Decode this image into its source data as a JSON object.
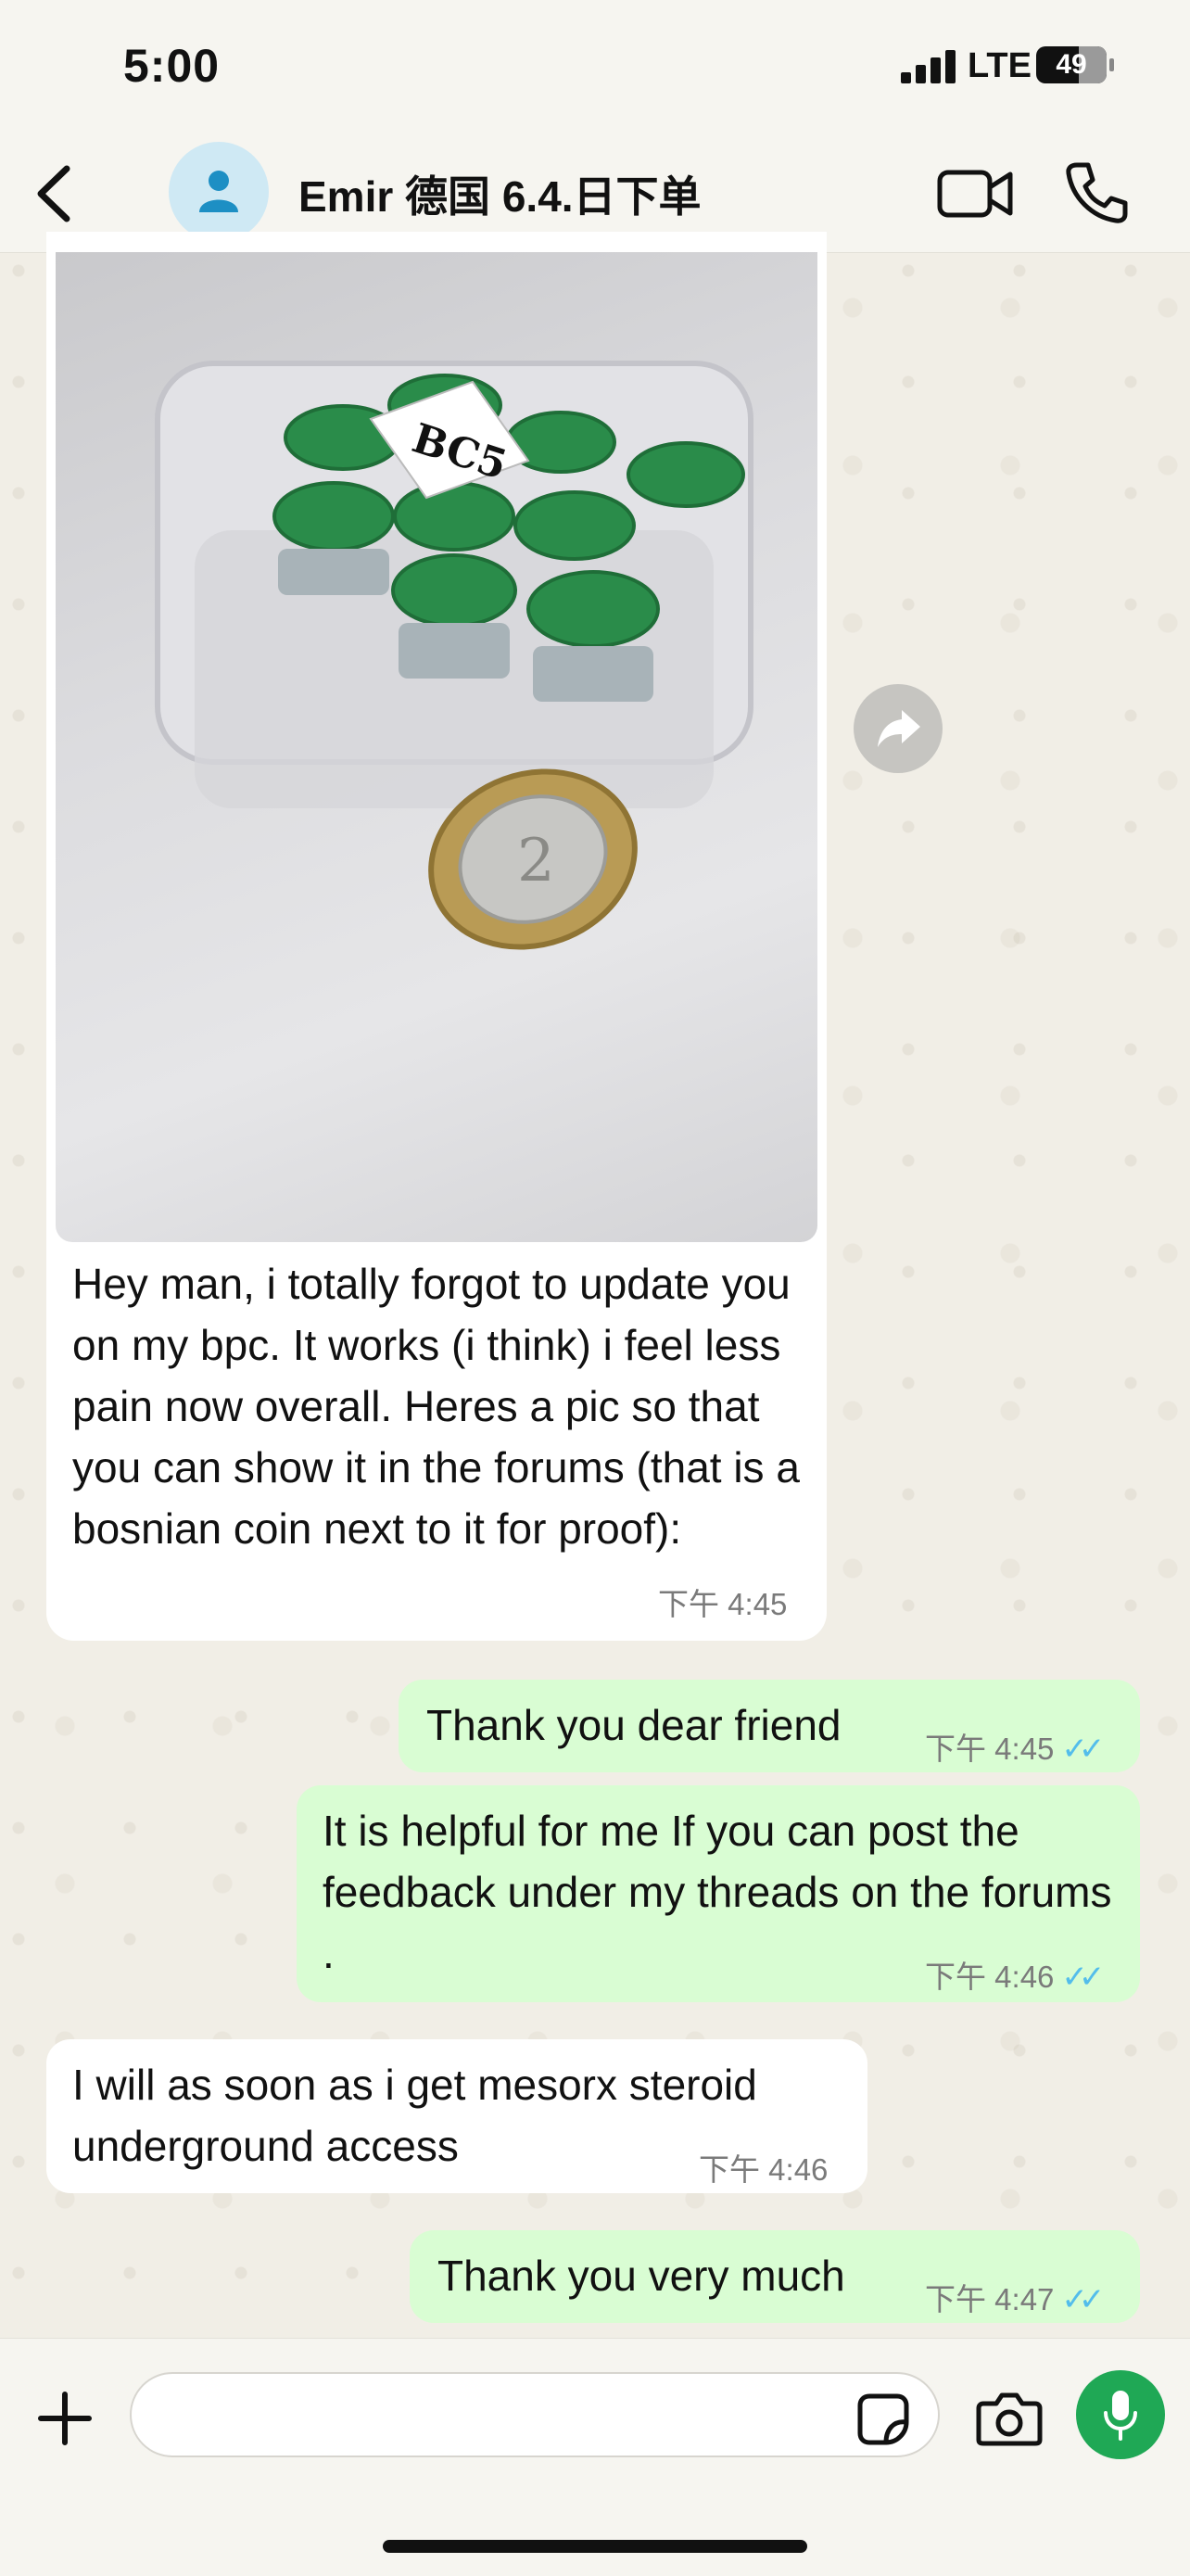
{
  "status_bar": {
    "time": "5:00",
    "network": "LTE",
    "battery": "49"
  },
  "header": {
    "contact_name": "Emir 德国 6.4.日下单"
  },
  "messages": [
    {
      "direction": "incoming",
      "has_image": true,
      "image_label": "BC5",
      "coin_text": "2",
      "text": "Hey man, i totally forgot to update you on my bpc. It works (i think) i feel less pain now overall. Heres a pic so that you can show it in the forums (that is a bosnian coin next to it for proof):",
      "time": "下午 4:45"
    },
    {
      "direction": "outgoing",
      "text": "Thank you dear friend",
      "time": "下午 4:45",
      "status": "read"
    },
    {
      "direction": "outgoing",
      "text": "It is helpful for me If you can post the feedback under my threads on the forums .",
      "time": "下午 4:46",
      "status": "read"
    },
    {
      "direction": "incoming",
      "text": "I will as soon as i get mesorx steroid underground access",
      "time": "下午 4:46"
    },
    {
      "direction": "outgoing",
      "text": "Thank you very much",
      "time": "下午 4:47",
      "status": "read"
    }
  ],
  "composer": {
    "value": "",
    "placeholder": ""
  },
  "icons": {
    "back": "chevron-left-icon",
    "avatar": "person-icon",
    "video": "video-camera-icon",
    "call": "phone-icon",
    "forward": "forward-icon",
    "plus": "plus-icon",
    "sticker": "sticker-icon",
    "camera": "camera-icon",
    "mic": "microphone-icon"
  },
  "colors": {
    "incoming_bubble": "#ffffff",
    "outgoing_bubble": "#d9fdd3",
    "read_ticks": "#53bdeb",
    "mic_button": "#1fa855"
  }
}
